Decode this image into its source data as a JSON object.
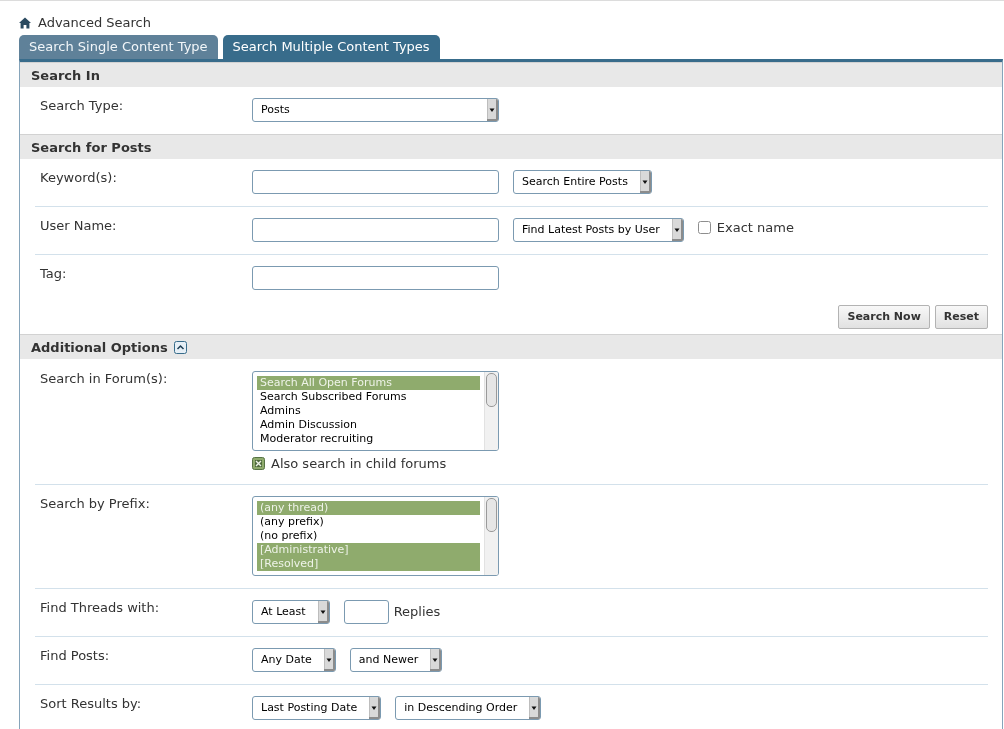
{
  "breadcrumb": {
    "label": "Advanced Search"
  },
  "tabs": [
    {
      "label": "Search Single Content Type",
      "selected": false
    },
    {
      "label": "Search Multiple Content Types",
      "selected": true
    }
  ],
  "sections": [
    {
      "title": "Search In",
      "rows": [
        {
          "label": "Search Type:",
          "controls": [
            {
              "kind": "wide-select",
              "value": "Posts"
            }
          ]
        }
      ]
    },
    {
      "title": "Search for Posts",
      "rows": [
        {
          "label": "Keyword(s):",
          "controls": [
            {
              "kind": "input"
            },
            {
              "kind": "select",
              "value": "Search Entire Posts"
            }
          ]
        },
        {
          "label": "User Name:",
          "controls": [
            {
              "kind": "input"
            },
            {
              "kind": "select",
              "value": "Find Latest Posts by User"
            },
            {
              "kind": "checkbox",
              "label": "Exact name",
              "checked": false
            }
          ]
        },
        {
          "label": "Tag:",
          "controls": [
            {
              "kind": "input"
            }
          ]
        }
      ],
      "buttons": [
        "Search Now",
        "Reset"
      ]
    },
    {
      "title": "Additional Options",
      "expanded": true,
      "rows": [
        {
          "label": "Search in Forum(s):",
          "controls": [
            {
              "kind": "listbox",
              "options": [
                {
                  "label": "Search All Open Forums",
                  "selected": true
                },
                {
                  "label": "Search Subscribed Forums",
                  "selected": false
                },
                {
                  "label": "Admins",
                  "selected": false
                },
                {
                  "label": "Admin Discussion",
                  "selected": false
                },
                {
                  "label": "Moderator recruiting",
                  "selected": false
                }
              ],
              "checkbox": {
                "label": "Also search in child forums",
                "checked": true
              }
            }
          ]
        },
        {
          "label": "Search by Prefix:",
          "controls": [
            {
              "kind": "listbox",
              "options": [
                {
                  "label": "(any thread)",
                  "selected": true
                },
                {
                  "label": "(any prefix)",
                  "selected": false
                },
                {
                  "label": "(no prefix)",
                  "selected": false
                },
                {
                  "label": "[Administrative]",
                  "selected": true
                },
                {
                  "label": "[Resolved]",
                  "selected": true
                }
              ]
            }
          ]
        },
        {
          "label": "Find Threads with:",
          "controls": [
            {
              "kind": "select",
              "value": "At Least"
            },
            {
              "kind": "short-input"
            },
            {
              "kind": "text",
              "text": "Replies"
            }
          ]
        },
        {
          "label": "Find Posts:",
          "controls": [
            {
              "kind": "select",
              "value": "Any Date"
            },
            {
              "kind": "select",
              "value": "and Newer"
            }
          ]
        },
        {
          "label": "Sort Results by:",
          "controls": [
            {
              "kind": "select",
              "value": "Last Posting Date"
            },
            {
              "kind": "select",
              "value": "in Descending Order"
            }
          ]
        }
      ]
    }
  ]
}
